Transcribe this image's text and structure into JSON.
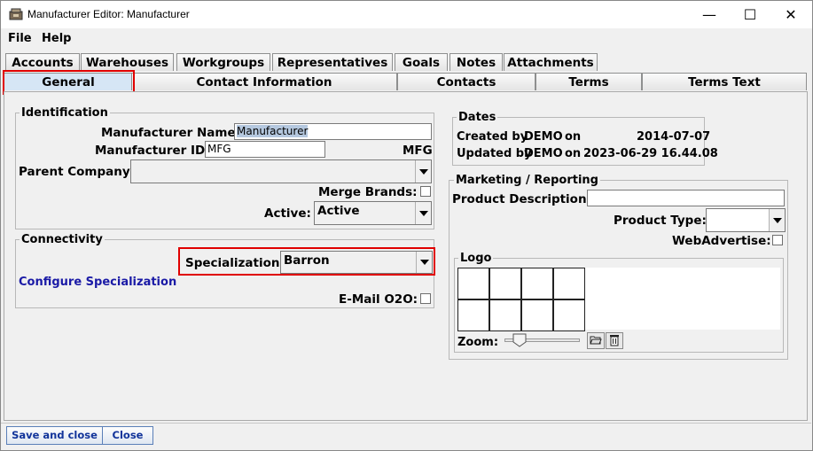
{
  "window": {
    "title": "Manufacturer Editor: Manufacturer",
    "minimize_glyph": "—",
    "maximize_glyph": "☐",
    "close_glyph": "✕"
  },
  "menu": {
    "file": "File",
    "help": "Help"
  },
  "tabs_row1": [
    "Accounts",
    "Warehouses",
    "Workgroups",
    "Representatives",
    "Goals",
    "Notes",
    "Attachments"
  ],
  "tabs_row2": [
    "General",
    "Contact Information",
    "Contacts",
    "Terms",
    "Terms Text"
  ],
  "selected_tab": "General",
  "identification": {
    "title": "Identification",
    "manufacturer_name_label": "Manufacturer Name:",
    "manufacturer_name_value": "Manufacturer",
    "manufacturer_id_label": "Manufacturer ID:",
    "manufacturer_id_value": "MFG",
    "manufacturer_id_display": "MFG",
    "parent_company_label": "Parent Company:",
    "parent_company_value": "",
    "merge_brands_label": "Merge Brands:",
    "merge_brands_checked": false,
    "active_label": "Active:",
    "active_value": "Active"
  },
  "connectivity": {
    "title": "Connectivity",
    "specialization_label": "Specialization:",
    "specialization_value": "Barron",
    "configure_link": "Configure Specialization",
    "email_o2o_label": "E-Mail O2O:",
    "email_o2o_checked": false
  },
  "dates": {
    "title": "Dates",
    "created_label": "Created by",
    "created_by": "DEMO",
    "created_on": "on",
    "created_date": "2014-07-07",
    "updated_label": "Updated by",
    "updated_by": "DEMO",
    "updated_on": "on",
    "updated_date": "2023-06-29 16.44.08"
  },
  "marketing": {
    "title": "Marketing / Reporting",
    "product_description_label": "Product Description:",
    "product_description_value": "",
    "product_type_label": "Product Type:",
    "product_type_value": "",
    "web_advertise_label": "WebAdvertise:",
    "web_advertise_checked": false
  },
  "logo": {
    "title": "Logo",
    "zoom_label": "Zoom:",
    "zoom_level": 0.1
  },
  "footer": {
    "save_close": "Save and close",
    "close": "Close"
  }
}
